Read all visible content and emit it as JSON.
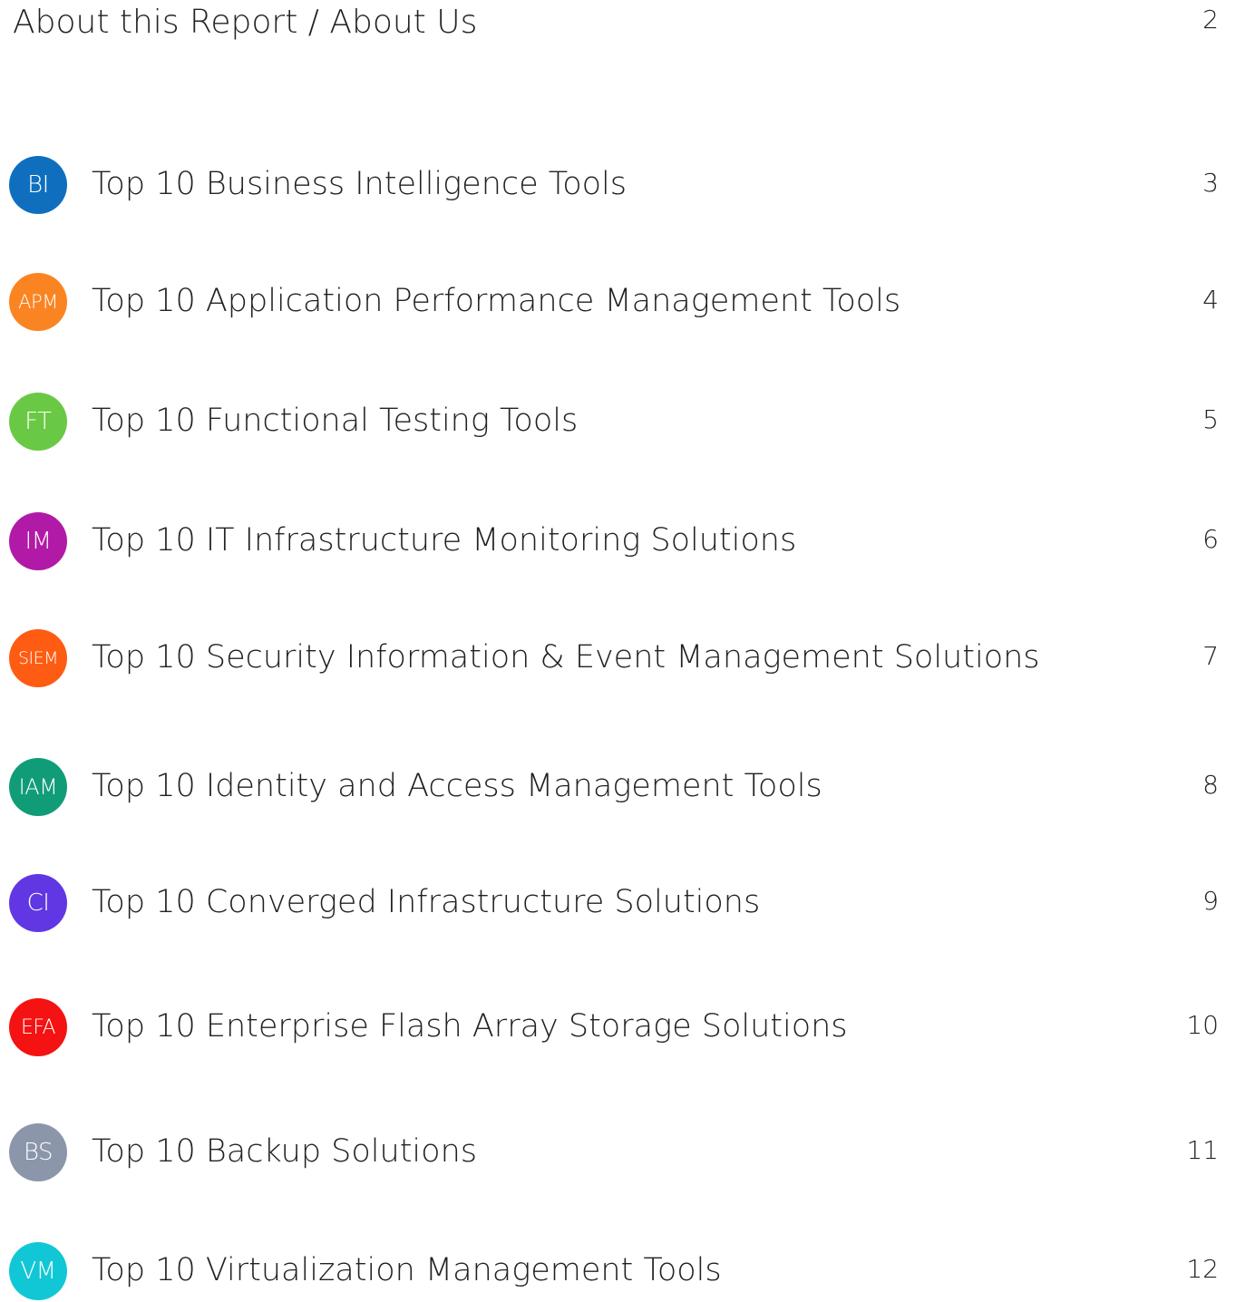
{
  "about": {
    "title": "About this Report / About Us",
    "page": "2"
  },
  "toc": [
    {
      "badge": "BI",
      "title": "Top 10 Business Intelligence Tools",
      "page": "3",
      "color": "#0f6fbe"
    },
    {
      "badge": "APM",
      "title": "Top 10 Application Performance Management Tools",
      "page": "4",
      "color": "#fb8422"
    },
    {
      "badge": "FT",
      "title": "Top 10 Functional Testing Tools",
      "page": "5",
      "color": "#6ac944"
    },
    {
      "badge": "IM",
      "title": "Top 10 IT Infrastructure Monitoring Solutions",
      "page": "6",
      "color": "#b11aa6"
    },
    {
      "badge": "SIEM",
      "title": "Top 10 Security Information & Event Management Solutions",
      "page": "7",
      "color": "#fe5c12"
    },
    {
      "badge": "IAM",
      "title": "Top 10 Identity and Access Management Tools",
      "page": "8",
      "color": "#119c78"
    },
    {
      "badge": "CI",
      "title": "Top 10 Converged Infrastructure Solutions",
      "page": "9",
      "color": "#6137e4"
    },
    {
      "badge": "EFA",
      "title": "Top 10 Enterprise Flash Array Storage Solutions",
      "page": "10",
      "color": "#f51212"
    },
    {
      "badge": "BS",
      "title": "Top 10 Backup Solutions",
      "page": "11",
      "color": "#8b96ab"
    },
    {
      "badge": "VM",
      "title": "Top 10 Virtualization Management Tools",
      "page": "12",
      "color": "#11c7d6"
    }
  ]
}
